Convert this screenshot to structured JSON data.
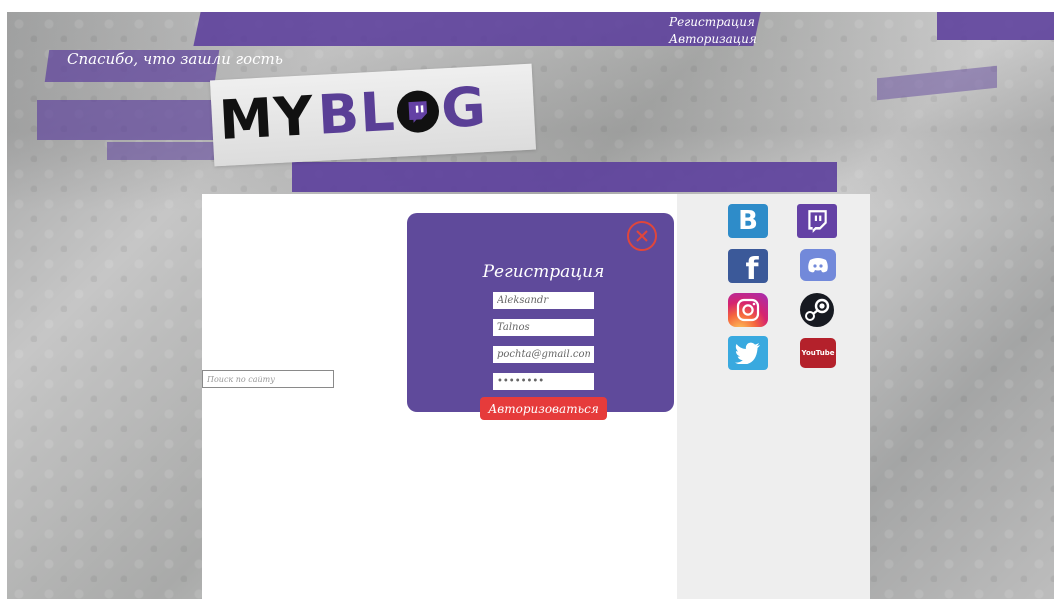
{
  "header": {
    "greeting": "Спасибо, что зашли гость",
    "nav": {
      "register": "Регистрация",
      "login": "Авторизация"
    },
    "logo": {
      "part1": "MY",
      "part2": "BL",
      "part3": "G"
    }
  },
  "search": {
    "placeholder": "Поиск по сайту"
  },
  "modal": {
    "title": "Регистрация",
    "fields": {
      "first_name": "Aleksandr",
      "last_name": "Talnos",
      "email": "pochta@gmail.com",
      "password": "••••••••"
    },
    "submit_label": "Авторизоваться"
  },
  "social": {
    "icons": [
      "vk-icon",
      "twitch-icon",
      "facebook-icon",
      "discord-icon",
      "instagram-icon",
      "steam-icon",
      "twitter-icon",
      "youtube-icon"
    ],
    "youtube_text": "YouTube",
    "vk_letter": "B",
    "facebook_letter": "f"
  },
  "colors": {
    "brand_purple": "#5f4a9b",
    "accent_red": "#e63b3b"
  }
}
